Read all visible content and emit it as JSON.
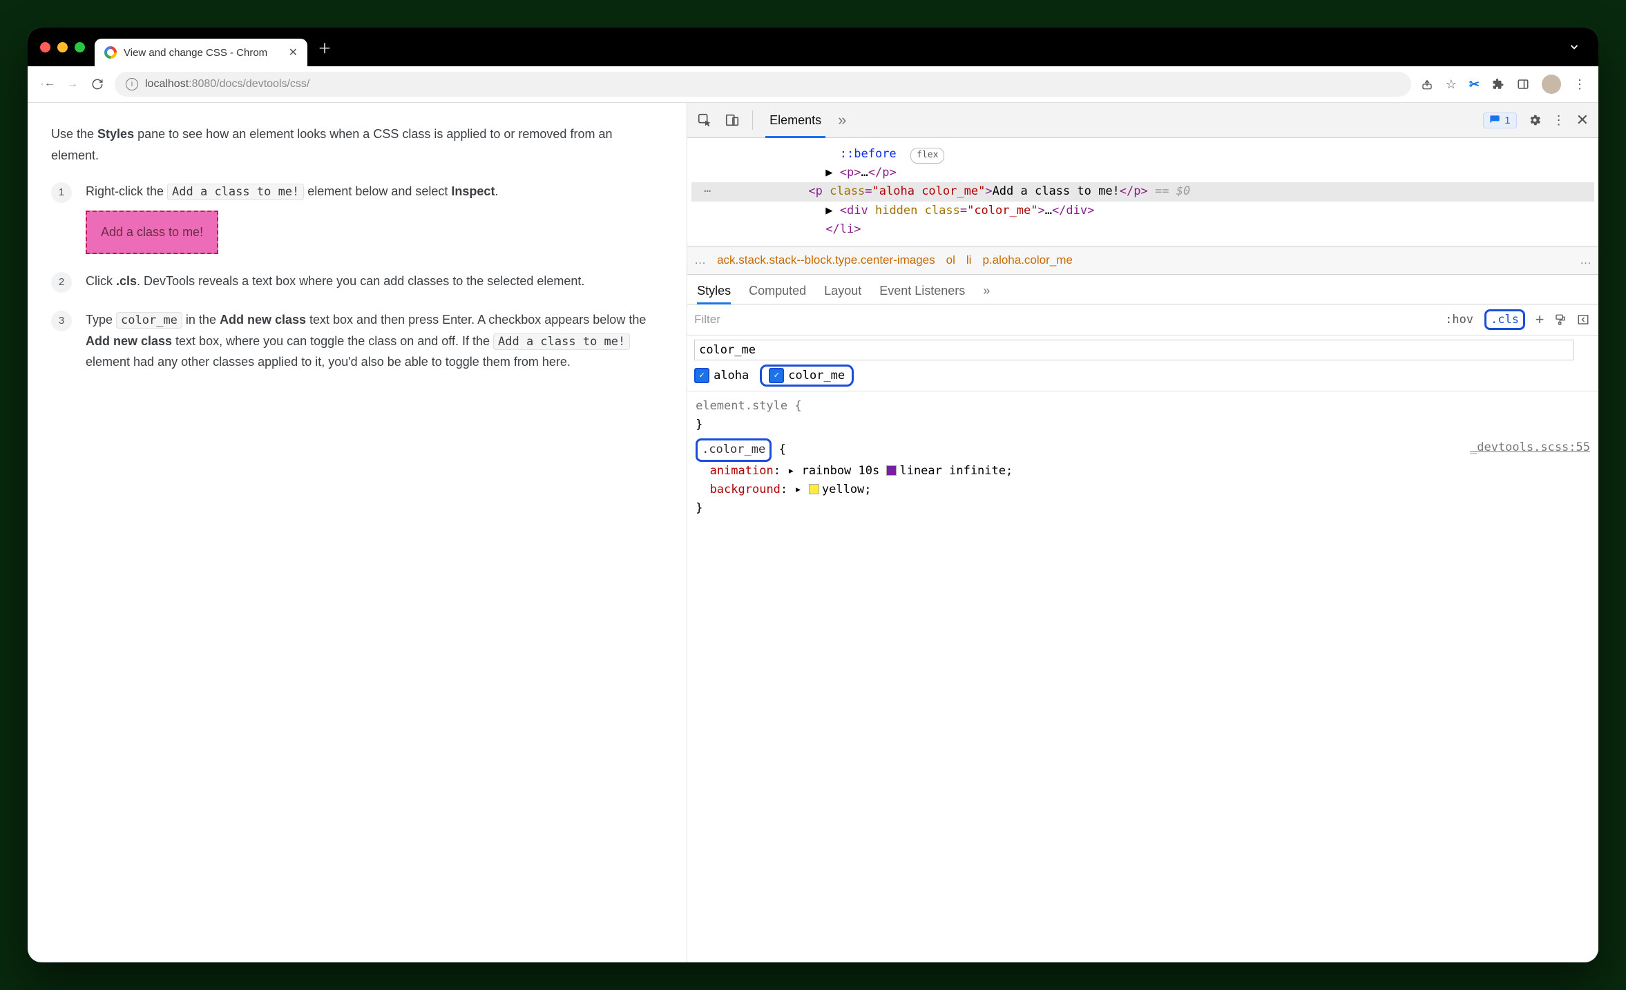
{
  "tab_title": "View and change CSS - Chrom",
  "url_host": "localhost",
  "url_port": ":8080",
  "url_path": "/docs/devtools/css/",
  "page": {
    "intro_part1": "Use the ",
    "intro_bold": "Styles",
    "intro_part2": " pane to see how an element looks when a CSS class is applied to or removed from an element.",
    "step1_a": "Right-click the ",
    "step1_code": "Add a class to me!",
    "step1_b": " element below and select ",
    "step1_bold": "Inspect",
    "step1_c": ".",
    "highlight_text": "Add a class to me!",
    "step2_a": "Click ",
    "step2_bold": ".cls",
    "step2_b": ". DevTools reveals a text box where you can add classes to the selected element.",
    "step3_a": "Type ",
    "step3_code1": "color_me",
    "step3_b": " in the ",
    "step3_bold1": "Add new class",
    "step3_c": " text box and then press Enter. A checkbox appears below the ",
    "step3_bold2": "Add new class",
    "step3_d": " text box, where you can toggle the class on and off. If the ",
    "step3_code2": "Add a class to me!",
    "step3_e": " element had any other classes applied to it, you'd also be able to toggle them from here."
  },
  "devtools": {
    "tab_elements": "Elements",
    "issues_count": "1",
    "dom": {
      "before": "::before",
      "flex_badge": "flex",
      "p_open": "<p>",
      "p_ell": "…",
      "p_close": "</p>",
      "sel_open_tag": "<p ",
      "sel_attr_class": "class",
      "sel_attr_val": "\"aloha color_me\"",
      "sel_gt": ">",
      "sel_text": "Add a class to me!",
      "sel_close": "</p>",
      "sel_eq": " == ",
      "sel_dollar": "$0",
      "div_open": "<div ",
      "div_hidden": "hidden",
      "div_class": "class",
      "div_val": "\"color_me\"",
      "div_gt": ">",
      "div_ell": "…",
      "div_close": "</div>",
      "li_close": "</li>"
    },
    "breadcrumb": {
      "first": "ack.stack.stack--block.type.center-images",
      "ol": "ol",
      "li": "li",
      "last": "p.aloha.color_me"
    },
    "styles_tabs": {
      "styles": "Styles",
      "computed": "Computed",
      "layout": "Layout",
      "events": "Event Listeners"
    },
    "filter_placeholder": "Filter",
    "hov": ":hov",
    "cls": ".cls",
    "cls_input": "color_me",
    "checkbox1": "aloha",
    "checkbox2": "color_me",
    "element_style": "element.style {",
    "brace_close": "}",
    "rule_selector": ".color_me",
    "rule_src": "_devtools.scss:55",
    "prop_anim": "animation",
    "val_anim": " rainbow 10s ",
    "val_anim2": "linear infinite;",
    "prop_bg": "background",
    "val_bg": "yellow;"
  }
}
